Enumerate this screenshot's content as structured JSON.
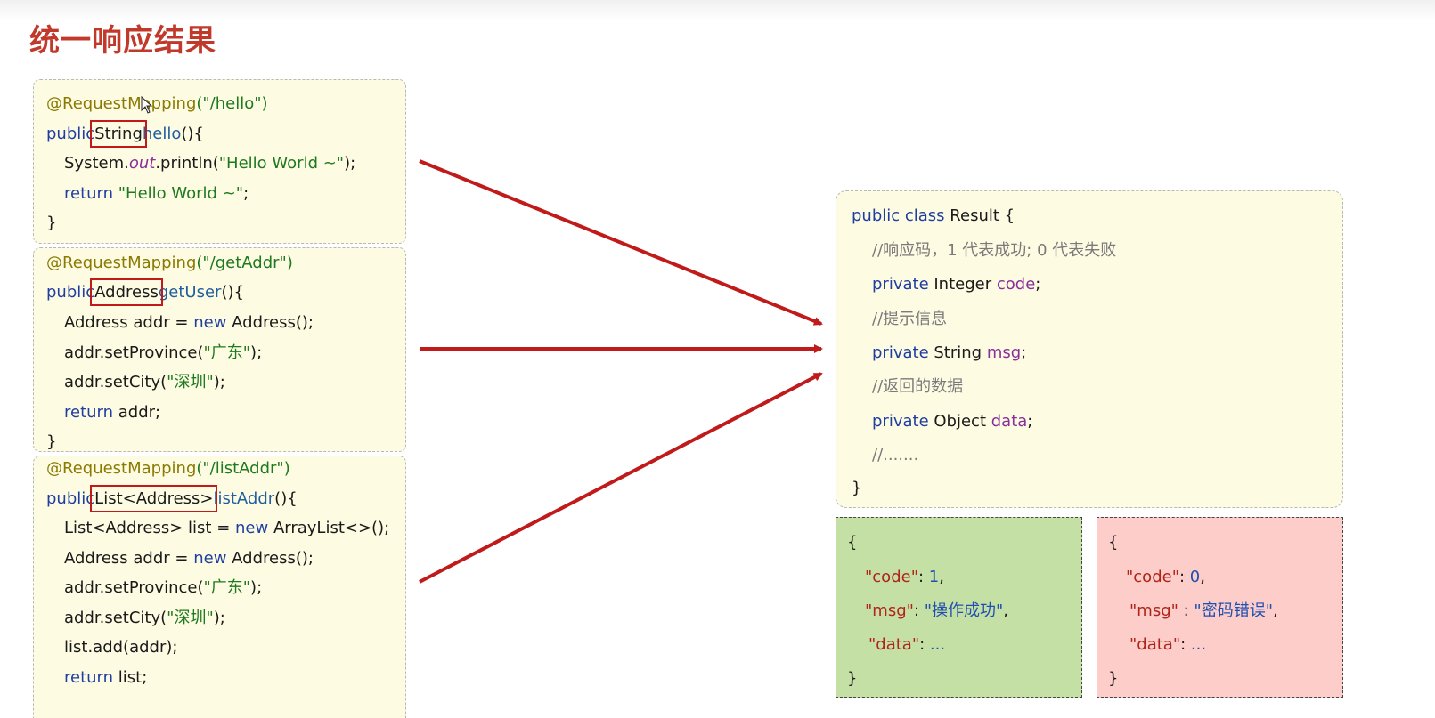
{
  "title": "统一响应结果",
  "code_blocks": [
    {
      "annotation": "@RequestMapping",
      "path": "(\"/hello\")",
      "decl": {
        "kw": "public",
        "type": "String",
        "name": "hello",
        "tail": "(){"
      },
      "body": [
        {
          "indent": true,
          "parts": [
            [
              "plain",
              "System."
            ],
            [
              "ital",
              "out"
            ],
            [
              "plain",
              ".println("
            ],
            [
              "str",
              "\"Hello World ~\""
            ],
            [
              "plain",
              ");"
            ]
          ]
        },
        {
          "indent": true,
          "parts": [
            [
              "kw",
              "return "
            ],
            [
              "str",
              "\"Hello World ~\""
            ],
            [
              "plain",
              ";"
            ]
          ]
        },
        {
          "indent": false,
          "parts": [
            [
              "plain",
              "}"
            ]
          ]
        }
      ]
    },
    {
      "annotation": "@RequestMapping",
      "path": "(\"/getAddr\")",
      "decl": {
        "kw": "public",
        "type": "Address",
        "name": "getUser",
        "tail": "(){"
      },
      "body": [
        {
          "indent": true,
          "parts": [
            [
              "plain",
              "Address addr = "
            ],
            [
              "kw",
              "new"
            ],
            [
              "plain",
              " Address();"
            ]
          ]
        },
        {
          "indent": true,
          "parts": [
            [
              "plain",
              "addr.setProvince("
            ],
            [
              "str",
              "\"广东\""
            ],
            [
              "plain",
              ");"
            ]
          ]
        },
        {
          "indent": true,
          "parts": [
            [
              "plain",
              "addr.setCity("
            ],
            [
              "str",
              "\"深圳\""
            ],
            [
              "plain",
              ");"
            ]
          ]
        },
        {
          "indent": true,
          "parts": [
            [
              "kw",
              "return"
            ],
            [
              "plain",
              " addr;"
            ]
          ]
        },
        {
          "indent": false,
          "parts": [
            [
              "plain",
              "}"
            ]
          ]
        }
      ]
    },
    {
      "annotation": "@RequestMapping",
      "path": "(\"/listAddr\")",
      "decl": {
        "kw": "public",
        "type": "List<Address>",
        "name": "listAddr",
        "tail": "(){"
      },
      "body": [
        {
          "indent": true,
          "parts": [
            [
              "plain",
              "List<Address> list = "
            ],
            [
              "kw",
              "new"
            ],
            [
              "plain",
              " ArrayList<>();"
            ]
          ]
        },
        {
          "indent": true,
          "parts": [
            [
              "plain",
              "Address addr = "
            ],
            [
              "kw",
              "new"
            ],
            [
              "plain",
              " Address();"
            ]
          ]
        },
        {
          "indent": true,
          "parts": [
            [
              "plain",
              "addr.setProvince("
            ],
            [
              "str",
              "\"广东\""
            ],
            [
              "plain",
              ");"
            ]
          ]
        },
        {
          "indent": true,
          "parts": [
            [
              "plain",
              "addr.setCity("
            ],
            [
              "str",
              "\"深圳\""
            ],
            [
              "plain",
              ");"
            ]
          ]
        },
        {
          "indent": true,
          "parts": [
            [
              "plain",
              "list.add(addr);"
            ]
          ]
        },
        {
          "indent": true,
          "parts": [
            [
              "kw",
              "return"
            ],
            [
              "plain",
              " list;"
            ]
          ]
        }
      ]
    }
  ],
  "result_class": {
    "header": [
      [
        "kw",
        "public class "
      ],
      [
        "plain",
        "Result {"
      ]
    ],
    "lines": [
      [
        [
          "cmt",
          "//响应码，1 代表成功; 0 代表失败"
        ]
      ],
      [
        [
          "kw",
          "private "
        ],
        [
          "plain",
          "Integer "
        ],
        [
          "fld",
          "code"
        ],
        [
          "plain",
          ";"
        ]
      ],
      [
        [
          "cmt",
          "//提示信息"
        ]
      ],
      [
        [
          "kw",
          "private "
        ],
        [
          "plain",
          "String "
        ],
        [
          "fld",
          "msg"
        ],
        [
          "plain",
          ";"
        ]
      ],
      [
        [
          "cmt",
          "//返回的数据"
        ]
      ],
      [
        [
          "kw",
          "private "
        ],
        [
          "plain",
          "Object "
        ],
        [
          "fld",
          "data"
        ],
        [
          "plain",
          ";"
        ]
      ],
      [
        [
          "cmt",
          "//......."
        ]
      ]
    ],
    "footer": "}"
  },
  "json_success": {
    "open": "{",
    "code_key": "\"code\"",
    "code_val": "1",
    "msg_key": "\"msg\"",
    "msg_val": "\"操作成功\"",
    "data_key": "\"data\"",
    "data_val": "...",
    "close": "}"
  },
  "json_error": {
    "open": "{",
    "code_key": "\"code\"",
    "code_val": "0",
    "msg_key": "\"msg\"",
    "msg_val": "\"密码错误\"",
    "data_key": "\"data\"",
    "data_val": "...",
    "close": "}"
  },
  "colors": {
    "title": "#c0392b",
    "arrow": "#c01a1a",
    "code_bg": "#fefbe3",
    "success_bg": "#c5e0a5",
    "error_bg": "#fdcdca"
  }
}
